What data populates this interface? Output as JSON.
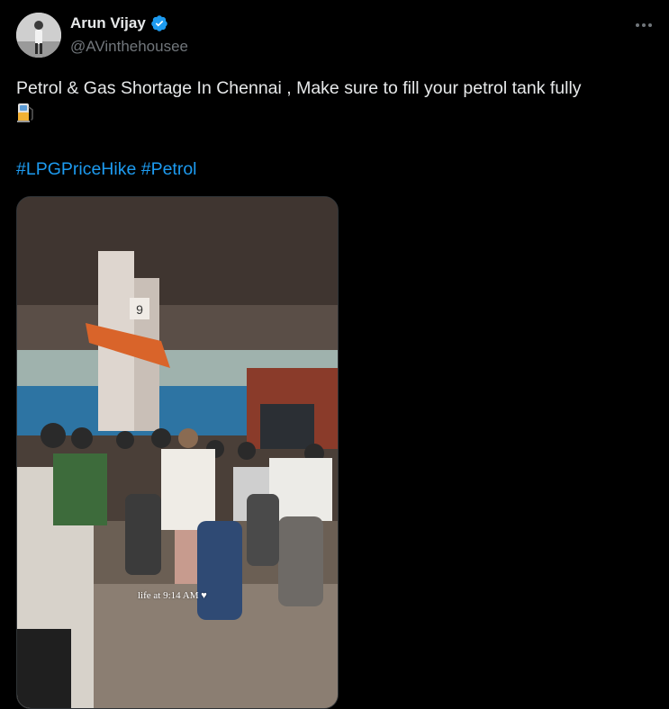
{
  "user": {
    "display_name": "Arun Vijay",
    "handle": "@AVinthehousee",
    "verified": true,
    "avatar_icon": "avatar-photo"
  },
  "actions": {
    "more_icon": "more-icon"
  },
  "tweet": {
    "text": "Petrol & Gas Shortage In Chennai , Make sure to fill your petrol tank fully",
    "emoji_icon": "fuel-pump-icon",
    "hashtags": [
      "#LPGPriceHike",
      "#Petrol"
    ]
  },
  "media": {
    "type": "video",
    "pump_number": "9",
    "caption": "life at 9:14 AM"
  },
  "colors": {
    "background": "#000000",
    "text": "#e7e9ea",
    "secondary_text": "#71767b",
    "link": "#1d9bf0",
    "verified": "#1d9bf0"
  }
}
